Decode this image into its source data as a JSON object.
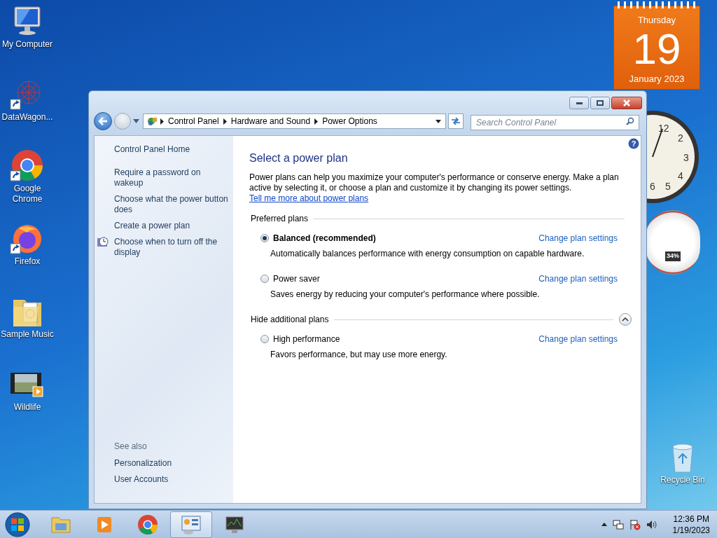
{
  "desktop_icons": [
    {
      "kind": "computer",
      "label": "My Computer"
    },
    {
      "kind": "network-art",
      "label": "DataWagon..."
    },
    {
      "kind": "chrome",
      "label": "Google Chrome"
    },
    {
      "kind": "firefox",
      "label": "Firefox"
    },
    {
      "kind": "music-folder",
      "label": "Sample Music"
    },
    {
      "kind": "video",
      "label": "Wildlife"
    },
    {
      "kind": "recycle-bin",
      "label": "Recycle Bin"
    }
  ],
  "calendar_gadget": {
    "weekday": "Thursday",
    "day": "19",
    "month_year": "January 2023"
  },
  "clock_gadget": {
    "numerals": [
      "12",
      "2",
      "3",
      "4",
      "6",
      "5"
    ]
  },
  "meter_gadget": {
    "reading": "34%"
  },
  "window": {
    "breadcrumbs": [
      "Control Panel",
      "Hardware and Sound",
      "Power Options"
    ],
    "search": {
      "placeholder": "Search Control Panel"
    },
    "sidebar": {
      "home": "Control Panel Home",
      "tasks": [
        {
          "label": "Require a password on wakeup",
          "kind": "plain"
        },
        {
          "label": "Choose what the power button does",
          "kind": "plain"
        },
        {
          "label": "Create a power plan",
          "kind": "plain"
        },
        {
          "label": "Choose when to turn off the display",
          "kind": "clock"
        }
      ],
      "see_also_heading": "See also",
      "see_also": [
        "Personalization",
        "User Accounts"
      ]
    },
    "help_glyph": "?",
    "title": "Select a power plan",
    "description": "Power plans can help you maximize your computer's performance or conserve energy. Make a plan active by selecting it, or choose a plan and customize it by changing its power settings.",
    "description_link": "Tell me more about power plans",
    "plan_groups": [
      {
        "heading": "Preferred plans",
        "plans": [
          {
            "name": "Balanced (recommended)",
            "selected": true,
            "description": "Automatically balances performance with energy consumption on capable hardware.",
            "link": "Change plan settings"
          },
          {
            "name": "Power saver",
            "selected": false,
            "description": "Saves energy by reducing your computer's performance where possible.",
            "link": "Change plan settings"
          }
        ]
      },
      {
        "heading": "Hide additional plans",
        "expanded": true,
        "plans": [
          {
            "name": "High performance",
            "selected": false,
            "description": "Favors performance, but may use more energy.",
            "link": "Change plan settings"
          }
        ]
      }
    ]
  },
  "taskbar": {
    "apps": [
      {
        "kind": "explorer",
        "selected": false
      },
      {
        "kind": "media-player",
        "selected": false
      },
      {
        "kind": "chrome",
        "selected": false
      },
      {
        "kind": "control-panel",
        "selected": true
      },
      {
        "kind": "monitor",
        "selected": false
      }
    ],
    "time": "12:36 PM",
    "date": "1/19/2023"
  }
}
